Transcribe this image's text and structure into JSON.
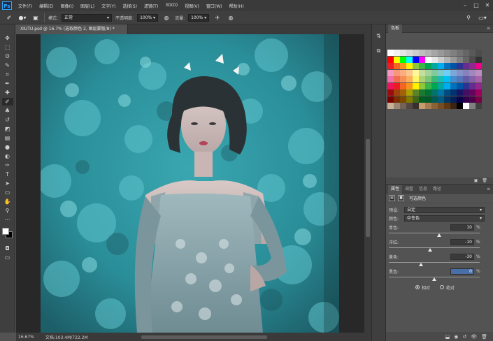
{
  "app": {
    "logo": "Ps"
  },
  "menu": [
    "文件(F)",
    "编辑(E)",
    "图像(I)",
    "图层(L)",
    "文字(Y)",
    "选择(S)",
    "滤镜(T)",
    "3D(D)",
    "视图(V)",
    "窗口(W)",
    "帮助(H)"
  ],
  "window_controls": {
    "minimize": "–",
    "maximize": "□",
    "close": "✕"
  },
  "options": {
    "mode_label": "模式:",
    "mode_value": "正常",
    "opacity_label": "不透明度:",
    "opacity_value": "100%",
    "flow_label": "流量:",
    "flow_value": "100%"
  },
  "document": {
    "tab_title": "XIUTU.psd @ 16.7% (选取颜色 2, 图层蒙版/8) *",
    "zoom": "16.67%",
    "doc_info": "文档:103.4M/722.2M"
  },
  "tools": [
    {
      "name": "move-tool",
      "glyph": "✥"
    },
    {
      "name": "marquee-tool",
      "glyph": "⬚"
    },
    {
      "name": "lasso-tool",
      "glyph": "ʘ"
    },
    {
      "name": "quick-select-tool",
      "glyph": "✎"
    },
    {
      "name": "crop-tool",
      "glyph": "⌗"
    },
    {
      "name": "eyedropper-tool",
      "glyph": "✒"
    },
    {
      "name": "healing-brush-tool",
      "glyph": "✚"
    },
    {
      "name": "brush-tool",
      "glyph": "✐",
      "active": true
    },
    {
      "name": "clone-stamp-tool",
      "glyph": "♣"
    },
    {
      "name": "history-brush-tool",
      "glyph": "↺"
    },
    {
      "name": "eraser-tool",
      "glyph": "◩"
    },
    {
      "name": "gradient-tool",
      "glyph": "▤"
    },
    {
      "name": "blur-tool",
      "glyph": "●"
    },
    {
      "name": "dodge-tool",
      "glyph": "◐"
    },
    {
      "name": "pen-tool",
      "glyph": "✑"
    },
    {
      "name": "type-tool",
      "glyph": "T"
    },
    {
      "name": "path-select-tool",
      "glyph": "➤"
    },
    {
      "name": "shape-tool",
      "glyph": "▭"
    },
    {
      "name": "hand-tool",
      "glyph": "✋"
    },
    {
      "name": "zoom-tool",
      "glyph": "⚲"
    },
    {
      "name": "more-tools",
      "glyph": "⋯"
    }
  ],
  "swatches": {
    "title": "色板",
    "colors": [
      [
        "#ffffff",
        "#f2f2f2",
        "#e6e6e6",
        "#d9d9d9",
        "#cccccc",
        "#bfbfbf",
        "#b3b3b3",
        "#a6a6a6",
        "#999999",
        "#8c8c8c",
        "#808080",
        "#737373",
        "#666666",
        "#595959",
        "#4d4d4d"
      ],
      [
        "#ff0000",
        "#ffff00",
        "#00ff00",
        "#00ffff",
        "#0000ff",
        "#ff00ff",
        "#ffffff",
        "#e6e6e6",
        "#cccccc",
        "#b3b3b3",
        "#999999",
        "#808080",
        "#666666",
        "#4d4d4d",
        "#333333"
      ],
      [
        "#ed1c24",
        "#f26522",
        "#f7941d",
        "#fff200",
        "#8dc63f",
        "#39b54a",
        "#00a651",
        "#00a99d",
        "#00aeef",
        "#0072bc",
        "#0054a6",
        "#2e3192",
        "#662d91",
        "#92278f",
        "#ec008c"
      ],
      [
        "#f49ac1",
        "#f7977a",
        "#f9ad81",
        "#fdc68a",
        "#fff799",
        "#c4df9b",
        "#a3d39c",
        "#82ca9c",
        "#7accc8",
        "#6dcff6",
        "#7da7d9",
        "#8393ca",
        "#8781bd",
        "#a187be",
        "#bd8cbf"
      ],
      [
        "#f06eaa",
        "#f26c4f",
        "#f68e56",
        "#fbaf5c",
        "#fff568",
        "#acd373",
        "#7cc576",
        "#3bb878",
        "#1abbb4",
        "#00bff3",
        "#448ccb",
        "#5674b9",
        "#605ca8",
        "#855fa8",
        "#a763a8"
      ],
      [
        "#ed145b",
        "#ed1c24",
        "#f26522",
        "#f7941d",
        "#fff200",
        "#8dc63f",
        "#39b54a",
        "#00a651",
        "#00a99d",
        "#00aeef",
        "#0072bc",
        "#0054a6",
        "#2e3192",
        "#662d91",
        "#92278f"
      ],
      [
        "#9e0b0f",
        "#a0410d",
        "#a36209",
        "#aba000",
        "#598527",
        "#1a7b30",
        "#007236",
        "#00746b",
        "#0076a3",
        "#004b80",
        "#003471",
        "#1b1464",
        "#440e62",
        "#630460",
        "#9e005d"
      ],
      [
        "#790000",
        "#7b2e00",
        "#7d4900",
        "#827b00",
        "#406618",
        "#005e20",
        "#005826",
        "#005952",
        "#005b7f",
        "#003663",
        "#002157",
        "#0d004c",
        "#32004b",
        "#4b0049",
        "#7b0046"
      ],
      [
        "#c7b299",
        "#998675",
        "#736357",
        "#534741",
        "#37302d",
        "#c69c6d",
        "#a67c52",
        "#8c6239",
        "#754c24",
        "#603913",
        "#3c2415",
        "#000000",
        "#ffffff",
        "#808080",
        "#404040"
      ]
    ]
  },
  "properties": {
    "tabs": [
      "属性",
      "调整",
      "信息",
      "路径"
    ],
    "adjustment_name": "可选颜色",
    "preset_label": "预设:",
    "preset_value": "自定",
    "colors_label": "颜色:",
    "colors_value": "中性色",
    "sliders": [
      {
        "label": "青色:",
        "value": "10",
        "pct": 55
      },
      {
        "label": "洋红:",
        "value": "-10",
        "pct": 45
      },
      {
        "label": "黄色:",
        "value": "-30",
        "pct": 35
      },
      {
        "label": "黑色:",
        "value": "0",
        "pct": 50,
        "editing": true
      }
    ],
    "percent_sign": "%",
    "method_relative": "相对",
    "method_absolute": "绝对",
    "method_selected": "relative"
  }
}
